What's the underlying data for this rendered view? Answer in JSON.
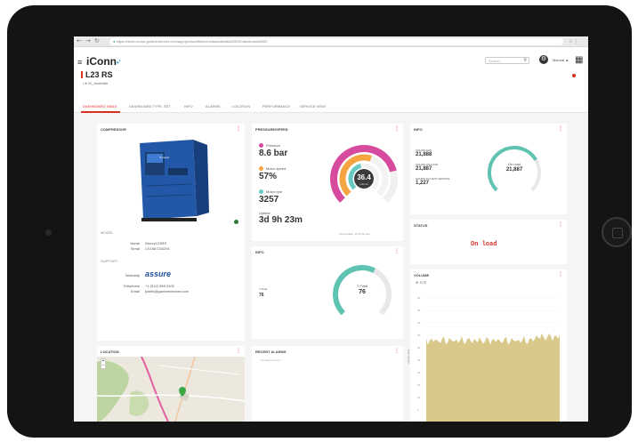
{
  "browser": {
    "nav": {
      "back": "←",
      "forward": "→",
      "reload": "↻"
    },
    "url": "https://demo.iconn.gardnerdenver.com/app/product/ltk/iconn/data/details/l83RS/dashboard/8000",
    "controls": "☆ ⋮"
  },
  "app": {
    "logo": "iConn",
    "logo_mark": "•'",
    "search_placeholder": "Search",
    "user_label": "Manual",
    "page_title": "L23 RS",
    "page_subtitle": "• ♦ 02_Australia"
  },
  "tabs": [
    {
      "label": "DASHBOARD TABLE",
      "active": true
    },
    {
      "label": "DASHBOARD TYPE: SET",
      "active": false
    },
    {
      "label": "INFO",
      "active": false
    },
    {
      "label": "ALARMS",
      "active": false
    },
    {
      "label": "LOCATION",
      "active": false
    },
    {
      "label": "PERFORMANCE",
      "active": false
    },
    {
      "label": "SERVICE VIEW",
      "active": false
    }
  ],
  "compressor": {
    "title": "COMPRESSOR",
    "model_label": "MODEL",
    "model_text": "Compair",
    "rows": [
      {
        "label": "Name",
        "value": "Demo/L23RS"
      },
      {
        "label": "Serial",
        "value": "CS1567234291"
      }
    ],
    "support_title": "SUPPORT",
    "support": [
      {
        "label": "Warranty",
        "value": "assure"
      },
      {
        "label": "Telephone",
        "value": "+1 (512) 555 0100"
      },
      {
        "label": "Email",
        "value": "jsmith@gardnerdenver.com"
      }
    ]
  },
  "pressure": {
    "title": "PRESSURE/SPEED",
    "metrics": [
      {
        "label": "Pressure",
        "value": "8.6 bar",
        "color": "#d64b9e"
      },
      {
        "label": "Motor speed",
        "value": "57%",
        "color": "#f5a442"
      },
      {
        "label": "Motor rpm",
        "value": "3257",
        "color": "#67c9c3"
      },
      {
        "label": "Uptime",
        "value": "3d 9h 23m"
      }
    ],
    "gauge_value": "36.4",
    "gauge_unit": "m3/min",
    "footer": "Last update: 12:34:55 ago",
    "arcs": {
      "pressure_fraction": 0.78,
      "speed_fraction": 0.57,
      "rpm_fraction": 0.45
    }
  },
  "info": {
    "title": "INFO",
    "rows": [
      {
        "label": "HOURS RUN",
        "value": "21,888"
      },
      {
        "label": "HOURS ON LOAD",
        "value": "21,887"
      },
      {
        "label": "HOURS TO NEXT SERVICE",
        "value": "1,227"
      }
    ],
    "gauge_label": "On load",
    "gauge_value": "21,887",
    "gauge_fraction": 0.72
  },
  "status": {
    "title": "STATUS",
    "value": "On load",
    "color": "#d93025"
  },
  "temp": {
    "title": "INFO",
    "label": "T Final",
    "value": "76",
    "side_value": "76",
    "side_label": "T Final",
    "gauge_fraction": 0.6
  },
  "volume": {
    "title": "VOLUME",
    "toolbar": "⊕ ⊖ ⊡",
    "ylabel": "Volume flow",
    "yticks": [
      "90",
      "80",
      "70",
      "60",
      "50",
      "40",
      "30",
      "20",
      "10",
      "0"
    ],
    "fill_color": "#d8c98a"
  },
  "location": {
    "title": "LOCATION",
    "zoom_in": "+",
    "zoom_out": "−"
  },
  "alarms": {
    "title": "RECENT ALARMS",
    "empty_text": "No alarms found"
  },
  "colors": {
    "accent": "#d93025",
    "teal": "#5fc3b1",
    "pink": "#d64b9e",
    "orange": "#f5a442"
  }
}
